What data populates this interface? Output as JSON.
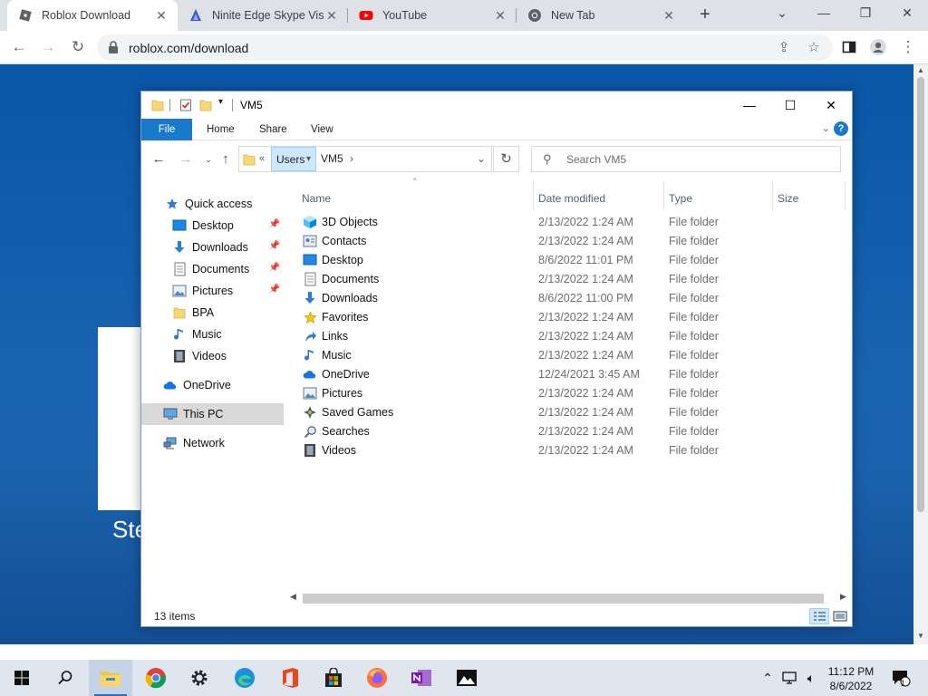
{
  "browser": {
    "tabs": [
      {
        "title": "Roblox Download",
        "icon": "roblox-icon",
        "active": true
      },
      {
        "title": "Ninite Edge Skype Visu",
        "icon": "ninite-icon",
        "active": false
      },
      {
        "title": "YouTube",
        "icon": "youtube-icon",
        "active": false
      },
      {
        "title": "New Tab",
        "icon": "chrome-icon",
        "active": false
      }
    ],
    "url": "roblox.com/download"
  },
  "webpage": {
    "partial_text": "Ste"
  },
  "explorer": {
    "title": "VM5",
    "ribbon_tabs": [
      "File",
      "Home",
      "Share",
      "View"
    ],
    "breadcrumb": {
      "overflow": "«",
      "segments": [
        "Users",
        "VM5"
      ]
    },
    "search_placeholder": "Search VM5",
    "nav_pane": [
      {
        "label": "Quick access",
        "icon": "star-icon",
        "pinned": false,
        "indent": 0
      },
      {
        "label": "Desktop",
        "icon": "desktop-folder-icon",
        "pinned": true,
        "indent": 1
      },
      {
        "label": "Downloads",
        "icon": "downloads-icon",
        "pinned": true,
        "indent": 1
      },
      {
        "label": "Documents",
        "icon": "documents-icon",
        "pinned": true,
        "indent": 1
      },
      {
        "label": "Pictures",
        "icon": "pictures-icon",
        "pinned": true,
        "indent": 1
      },
      {
        "label": "BPA",
        "icon": "folder-icon",
        "pinned": false,
        "indent": 1
      },
      {
        "label": "Music",
        "icon": "music-icon",
        "pinned": false,
        "indent": 1
      },
      {
        "label": "Videos",
        "icon": "videos-icon",
        "pinned": false,
        "indent": 1
      },
      {
        "label": "OneDrive",
        "icon": "onedrive-icon",
        "pinned": false,
        "indent": 0
      },
      {
        "label": "This PC",
        "icon": "this-pc-icon",
        "pinned": false,
        "indent": 0,
        "selected": true
      },
      {
        "label": "Network",
        "icon": "network-icon",
        "pinned": false,
        "indent": 0
      }
    ],
    "columns": [
      "Name",
      "Date modified",
      "Type",
      "Size"
    ],
    "files": [
      {
        "name": "3D Objects",
        "date": "2/13/2022 1:24 AM",
        "type": "File folder",
        "icon": "3d-objects-icon"
      },
      {
        "name": "Contacts",
        "date": "2/13/2022 1:24 AM",
        "type": "File folder",
        "icon": "contacts-icon"
      },
      {
        "name": "Desktop",
        "date": "8/6/2022 11:01 PM",
        "type": "File folder",
        "icon": "desktop-folder-icon"
      },
      {
        "name": "Documents",
        "date": "2/13/2022 1:24 AM",
        "type": "File folder",
        "icon": "documents-icon"
      },
      {
        "name": "Downloads",
        "date": "8/6/2022 11:00 PM",
        "type": "File folder",
        "icon": "downloads-icon"
      },
      {
        "name": "Favorites",
        "date": "2/13/2022 1:24 AM",
        "type": "File folder",
        "icon": "favorites-icon"
      },
      {
        "name": "Links",
        "date": "2/13/2022 1:24 AM",
        "type": "File folder",
        "icon": "links-icon"
      },
      {
        "name": "Music",
        "date": "2/13/2022 1:24 AM",
        "type": "File folder",
        "icon": "music-icon"
      },
      {
        "name": "OneDrive",
        "date": "12/24/2021 3:45 AM",
        "type": "File folder",
        "icon": "onedrive-icon"
      },
      {
        "name": "Pictures",
        "date": "2/13/2022 1:24 AM",
        "type": "File folder",
        "icon": "pictures-icon"
      },
      {
        "name": "Saved Games",
        "date": "2/13/2022 1:24 AM",
        "type": "File folder",
        "icon": "saved-games-icon"
      },
      {
        "name": "Searches",
        "date": "2/13/2022 1:24 AM",
        "type": "File folder",
        "icon": "searches-icon"
      },
      {
        "name": "Videos",
        "date": "2/13/2022 1:24 AM",
        "type": "File folder",
        "icon": "videos-icon"
      }
    ],
    "status": "13 items"
  },
  "taskbar": {
    "apps": [
      "start-icon",
      "search-icon",
      "file-explorer-icon",
      "chrome-icon",
      "settings-icon",
      "edge-icon",
      "office-icon",
      "store-icon",
      "firefox-icon",
      "onenote-icon",
      "photos-icon"
    ],
    "time": "11:12 PM",
    "date": "8/6/2022",
    "notification_count": "1"
  },
  "colors": {
    "accent": "#1979ca",
    "page_blue": "#0a57a8",
    "selection": "#cce8ff"
  }
}
